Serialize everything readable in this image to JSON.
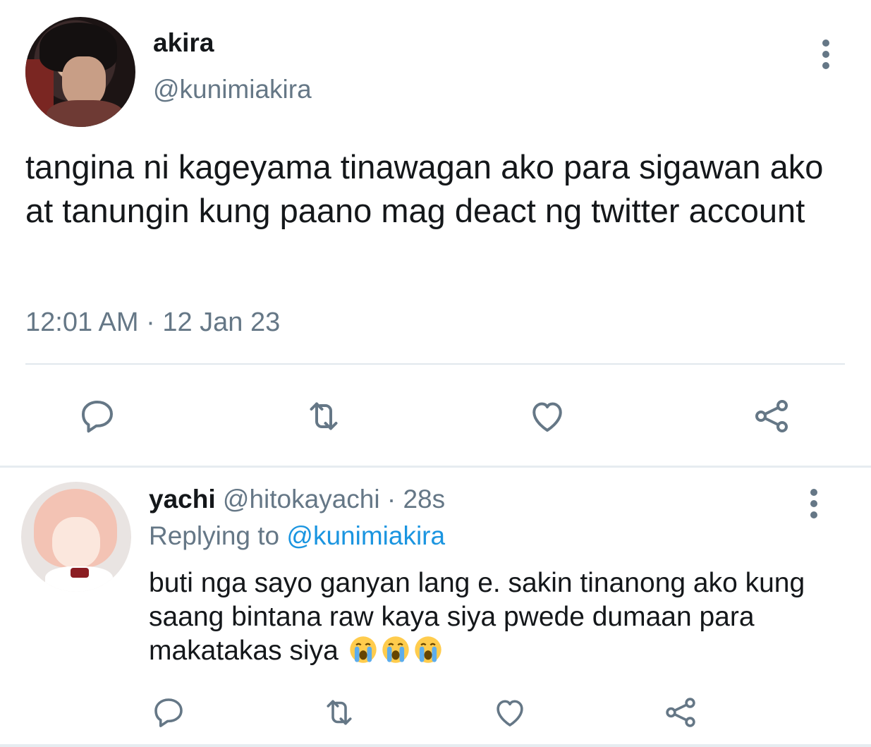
{
  "main_tweet": {
    "display_name": "akira",
    "handle": "@kunimiakira",
    "text": "tangina ni kageyama tinawagan ako para sigawan ako at tanungin kung paano mag deact ng twitter account",
    "timestamp": "12:01 AM · 12 Jan 23",
    "actions": [
      "reply-icon",
      "retweet-icon",
      "like-icon",
      "share-icon"
    ]
  },
  "reply_tweet": {
    "display_name": "yachi",
    "handle": "@hitokayachi",
    "age": "28s",
    "replying_prefix": "Replying to",
    "replying_to": "@kunimiakira",
    "text": "buti nga sayo ganyan lang e. sakin tinanong ako kung saang bintana raw kaya siya pwede dumaan para makatakas siya",
    "emojis": [
      "loudly-crying-face-emoji",
      "loudly-crying-face-emoji",
      "loudly-crying-face-emoji"
    ],
    "actions": [
      "reply-icon",
      "retweet-icon",
      "like-icon",
      "share-icon"
    ]
  },
  "colors": {
    "text_primary": "#14171a",
    "text_secondary": "#657786",
    "link": "#1b95e0",
    "divider": "#e1e8ed"
  }
}
